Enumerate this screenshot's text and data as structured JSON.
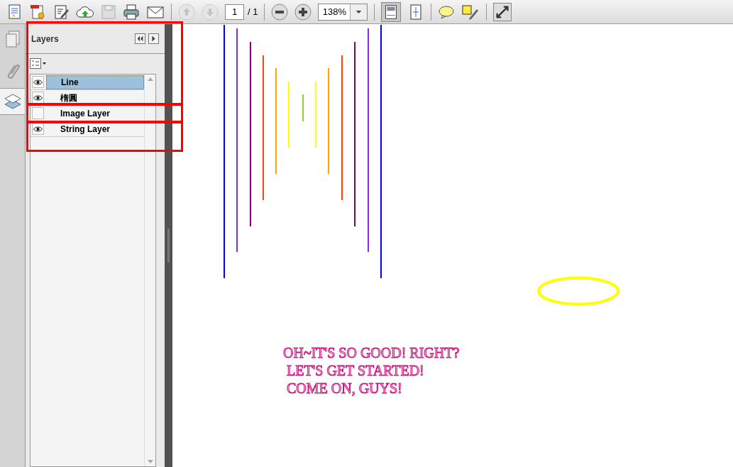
{
  "toolbar": {
    "page_number": "1",
    "page_total": "/ 1",
    "zoom": "138%"
  },
  "panel": {
    "title": "Layers"
  },
  "layers": [
    {
      "name": "Line",
      "visible": true,
      "selected": true
    },
    {
      "name": "楕圓",
      "visible": true,
      "selected": false
    },
    {
      "name": "Image Layer",
      "visible": false,
      "selected": false
    },
    {
      "name": "String Layer",
      "visible": true,
      "selected": false
    }
  ],
  "document": {
    "text_lines": [
      "OH~IT'S SO GOOD! RIGHT?",
      " LET'S GET STARTED!",
      " COME ON, GUYS!"
    ]
  }
}
